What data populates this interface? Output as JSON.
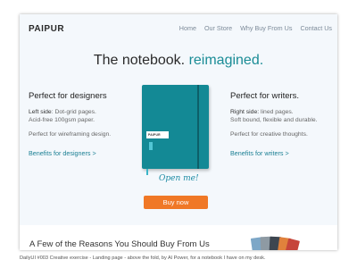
{
  "nav": {
    "brand": "PAIPUR",
    "items": [
      {
        "label": "Home"
      },
      {
        "label": "Our Store"
      },
      {
        "label": "Why Buy From Us"
      },
      {
        "label": "Contact Us"
      }
    ]
  },
  "hero": {
    "headline_main": "The notebook.",
    "headline_accent": "reimagined."
  },
  "left": {
    "title": "Perfect for designers",
    "line1_bold": "Left side",
    "line1_rest": ": Dot-grid pages.",
    "line2": "Acid-free 100gsm paper.",
    "line3": "Perfect for wireframing design.",
    "link": "Benefits for designers >"
  },
  "right": {
    "title": "Perfect for writers.",
    "line1_bold": "Right side:",
    "line1_rest": " lined pages.",
    "line2": "Soft bound, flexible and durable.",
    "line3": "Perfect for creative thoughts.",
    "link": "Benefits for writers >"
  },
  "notebook": {
    "brand": "PAIPUR"
  },
  "handwritten": "Open me!",
  "cta": {
    "label": "Buy now"
  },
  "section": {
    "title": "A Few of the Reasons You Should Buy From Us"
  },
  "caption": "DailyUI #003 Creative exercise - Landing page - above the fold, by Al Power, for a notebook I have on my desk.",
  "colors": {
    "accent": "#1a8c96",
    "cta": "#f07826",
    "notebook": "#138995",
    "background": "#f4f8fc"
  }
}
